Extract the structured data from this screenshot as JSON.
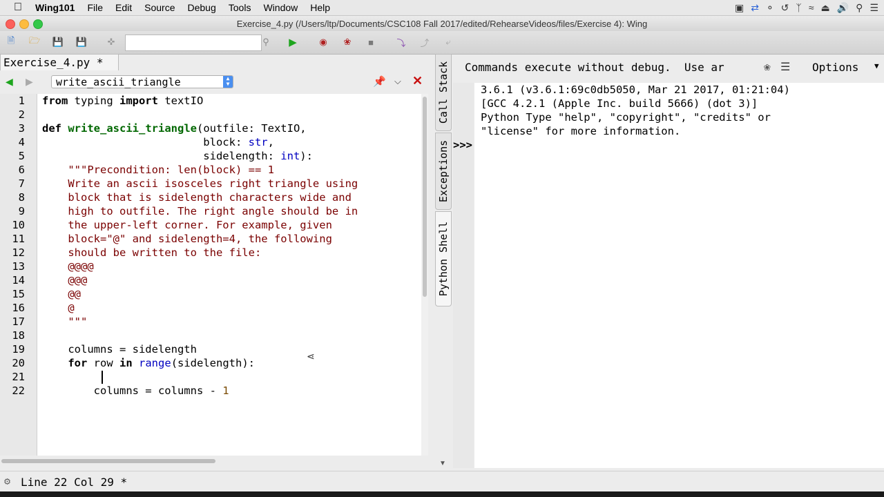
{
  "menubar": {
    "apple": "",
    "app": "Wing101",
    "items": [
      "File",
      "Edit",
      "Source",
      "Debug",
      "Tools",
      "Window",
      "Help"
    ],
    "status_icons": [
      "screen-record-icon",
      "sync-icon",
      "glasses-icon",
      "time-machine-icon",
      "bluetooth-icon",
      "wifi-icon",
      "eject-icon",
      "volume-icon",
      "spotlight-icon",
      "notification-list-icon"
    ]
  },
  "window": {
    "title": "Exercise_4.py (/Users/ltp/Documents/CSC108 Fall 2017/edited/RehearseVideos/files/Exercise 4): Wing"
  },
  "toolbar": {
    "buttons": [
      "new-file",
      "open-file",
      "save-file",
      "save-all",
      "indent-tool",
      "run",
      "stop-point",
      "debug",
      "stop",
      "step-into",
      "step-over",
      "step-out"
    ],
    "search_value": ""
  },
  "editor": {
    "tab_label": "Exercise_4.py *",
    "function_selector": "write_ascii_triangle",
    "lines": [
      "from typing import textIO",
      "",
      "def write_ascii_triangle(outfile: TextIO,",
      "                         block: str,",
      "                         sidelength: int):",
      "    \"\"\"Precondition: len(block) == 1",
      "    Write an ascii isosceles right triangle using",
      "    block that is sidelength characters wide and",
      "    high to outfile. The right angle should be in",
      "    the upper-left corner. For example, given",
      "    block=\"@\" and sidelength=4, the following",
      "    should be written to the file:",
      "    @@@@",
      "    @@@",
      "    @@",
      "    @",
      "    \"\"\"",
      "",
      "    columns = sidelength",
      "    for row in range(sidelength):",
      "        ",
      "        columns = columns - 1"
    ]
  },
  "side_tabs": [
    "Call Stack",
    "Exceptions",
    "Python Shell"
  ],
  "shell": {
    "header_text": "Commands execute without debug.  Use ar",
    "options_label": "Options",
    "prompt": ">>>",
    "output_lines": [
      "3.6.1 (v3.6.1:69c0db5050, Mar 21 2017, 01:21:04)",
      "[GCC 4.2.1 (Apple Inc. build 5666) (dot 3)]",
      "Python Type \"help\", \"copyright\", \"credits\" or",
      "\"license\" for more information."
    ]
  },
  "statusbar": {
    "text": "Line 22 Col 29 *"
  }
}
